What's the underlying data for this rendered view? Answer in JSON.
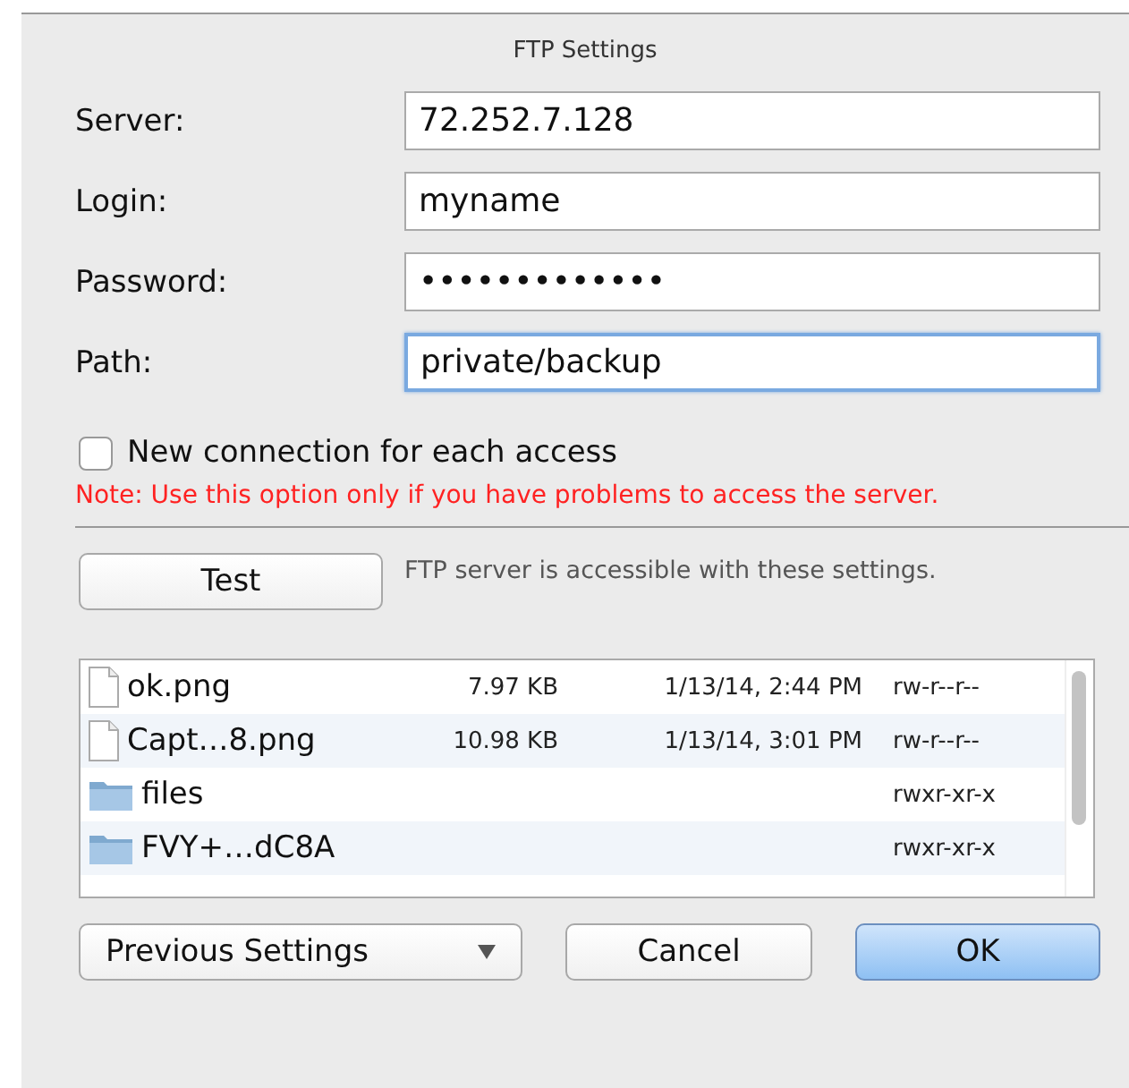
{
  "dialog": {
    "title": "FTP Settings"
  },
  "fields": [
    {
      "label": "Server:",
      "value": "72.252.7.128",
      "focused": false
    },
    {
      "label": "Login:",
      "value": "myname",
      "focused": false
    },
    {
      "label": "Password:",
      "value": "•••••••••••••",
      "focused": false
    },
    {
      "label": "Path:",
      "value": "private/backup",
      "focused": true
    }
  ],
  "option": {
    "label": "New connection for each access",
    "checked": false
  },
  "note": "Note: Use this option only if you have problems to access the server.",
  "test": {
    "button": "Test",
    "status": "FTP server is accessible with these settings."
  },
  "files": [
    {
      "kind": "file",
      "name": "ok.png",
      "size": "7.97 KB",
      "date": "1/13/14, 2:44 PM",
      "permissions": "rw-r--r--"
    },
    {
      "kind": "file",
      "name": "Capt…8.png",
      "size": "10.98 KB",
      "date": "1/13/14, 3:01 PM",
      "permissions": "rw-r--r--"
    },
    {
      "kind": "folder",
      "name": "files",
      "permissions": "rwxr-xr-x"
    },
    {
      "kind": "folder",
      "name": "FVY+…dC8A",
      "permissions": "rwxr-xr-x"
    }
  ],
  "buttons": {
    "popup": "Previous Settings",
    "cancel": "Cancel",
    "ok": "OK"
  }
}
